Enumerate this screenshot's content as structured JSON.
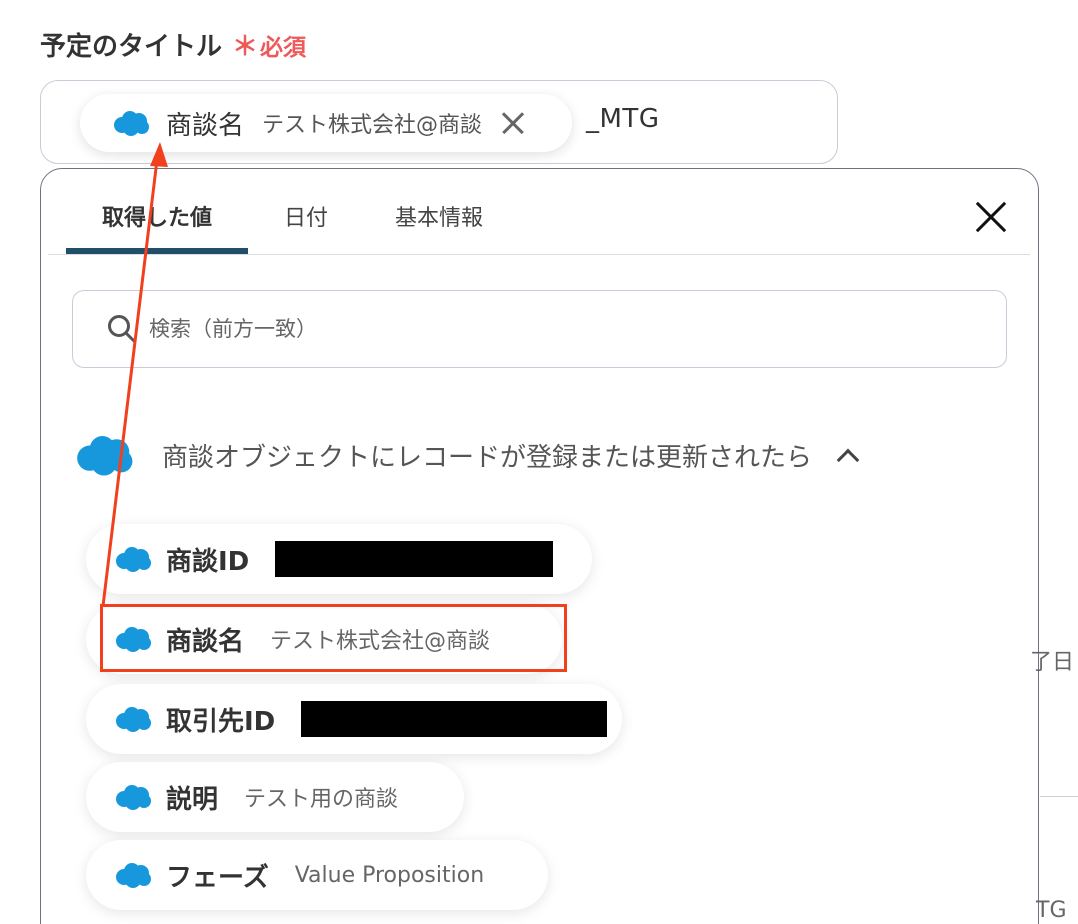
{
  "field": {
    "label": "予定のタイトル",
    "required_mark": "＊",
    "required_text": "必須",
    "required_color": "#ee5a5a"
  },
  "title_input": {
    "chip": {
      "icon": "salesforce-cloud-icon",
      "name": "商談名",
      "value": "テスト株式会社@商談",
      "remove_icon": "close-icon"
    },
    "suffix": "_MTG"
  },
  "panel": {
    "tabs": [
      {
        "label": "取得した値",
        "active": true
      },
      {
        "label": "日付",
        "active": false
      },
      {
        "label": "基本情報",
        "active": false
      }
    ],
    "close_icon": "close-icon",
    "search": {
      "placeholder": "検索（前方一致）",
      "value": "",
      "icon": "search-icon"
    },
    "section": {
      "icon": "salesforce-cloud-icon",
      "title": "商談オブジェクトにレコードが登録または更新されたら",
      "toggle_icon": "chevron-up-icon"
    },
    "items": [
      {
        "name": "商談ID",
        "value": "",
        "redacted": true
      },
      {
        "name": "商談名",
        "value": "テスト株式会社@商談",
        "redacted": false,
        "highlighted": true
      },
      {
        "name": "取引先ID",
        "value": "",
        "redacted": true
      },
      {
        "name": "説明",
        "value": "テスト用の商談",
        "redacted": false
      },
      {
        "name": "フェーズ",
        "value": "Value Proposition",
        "redacted": false
      }
    ]
  },
  "background_fragments": {
    "right_text_1": "了日",
    "right_text_2": "TG"
  },
  "colors": {
    "tab_active_underline": "#1f4f6b",
    "highlight_border": "#f1401d",
    "arrow": "#f1401d",
    "cloud": "#1798dc"
  }
}
